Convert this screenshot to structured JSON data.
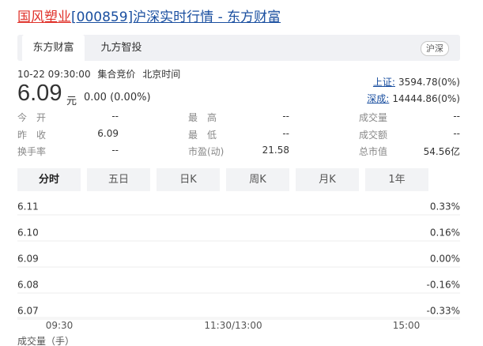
{
  "header": {
    "stock_name": "国风塑业",
    "title_rest": "[000859]沪深实时行情 - 东方财富"
  },
  "tabs": {
    "items": [
      "东方财富",
      "九方智投"
    ],
    "badge": "沪深"
  },
  "quote": {
    "time": "10-22 09:30:00",
    "status": "集合竞价",
    "timezone": "北京时间",
    "price": "6.09",
    "unit": "元",
    "change": "0.00 (0.00%)"
  },
  "indices": [
    {
      "name": "上证:",
      "value": "3594.78(0%)"
    },
    {
      "name": "深成:",
      "value": "14444.86(0%)"
    }
  ],
  "stats": [
    {
      "label": "今　开",
      "value": "--"
    },
    {
      "label": "最　高",
      "value": "--"
    },
    {
      "label": "成交量",
      "value": "--"
    },
    {
      "label": "昨　收",
      "value": "6.09"
    },
    {
      "label": "最　低",
      "value": "--"
    },
    {
      "label": "成交额",
      "value": "--"
    },
    {
      "label": "换手率",
      "value": "--"
    },
    {
      "label": "市盈(动)",
      "value": "21.58"
    },
    {
      "label": "总市值",
      "value": "54.56亿"
    }
  ],
  "period_tabs": [
    "分时",
    "五日",
    "日K",
    "周K",
    "月K",
    "1年"
  ],
  "chart_data": {
    "type": "line",
    "title": "",
    "xlabel": "",
    "ylabel": "",
    "y_ticks": [
      "6.11",
      "6.10",
      "6.09",
      "6.08",
      "6.07"
    ],
    "y_right_ticks": [
      "0.33%",
      "0.16%",
      "0.00%",
      "-0.16%",
      "-0.33%"
    ],
    "x_ticks": [
      "09:30",
      "11:30/13:00",
      "15:00"
    ],
    "ylim": [
      6.07,
      6.11
    ],
    "grid": true,
    "series": []
  },
  "footer_partial": "成交量（手）"
}
